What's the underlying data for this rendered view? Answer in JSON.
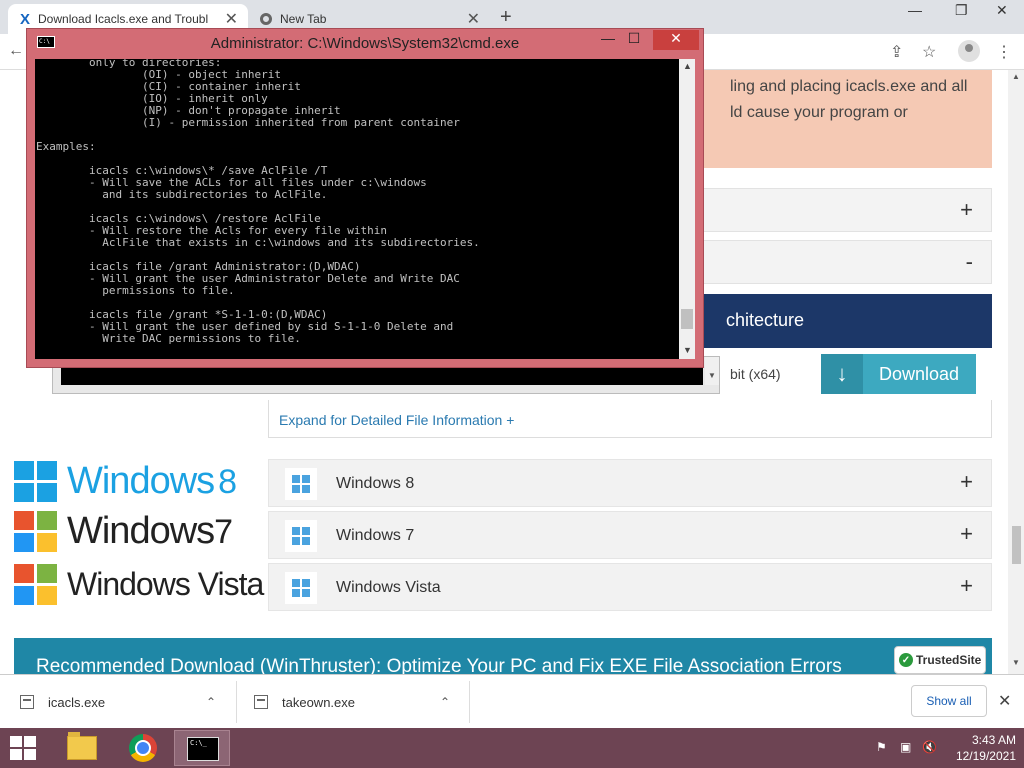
{
  "browser": {
    "tabs": [
      {
        "title": "Download Icacls.exe and Trouble",
        "close": "✕"
      },
      {
        "title": "New Tab",
        "close": "✕"
      }
    ],
    "new_tab": "+",
    "window_controls": {
      "minimize": "—",
      "restore": "❐",
      "close": "✕"
    },
    "back": "←",
    "share": "⇪",
    "bookmark": "☆",
    "menu": "⋮"
  },
  "page": {
    "banner_text": "ling and placing icacls.exe and all\nld cause your program or",
    "accordion_expand": "+",
    "accordion_collapse": "-",
    "architecture_title": "chitecture",
    "bit_label": "bit (x64)",
    "download_button": "Download",
    "download_arrow": "↓",
    "expand_details": "Expand for Detailed File Information +",
    "os_logos": [
      {
        "name": "Windows 8",
        "sup": "8"
      },
      {
        "name": "Windows 7",
        "sup": "7"
      },
      {
        "name": "Windows Vista"
      }
    ],
    "os_logo_text": [
      "Windows",
      "Windows",
      "Windows Vista"
    ],
    "os_logo_num": [
      "8",
      "7"
    ],
    "os_rows": [
      {
        "label": "Windows 8",
        "expand": "+"
      },
      {
        "label": "Windows 7",
        "expand": "+"
      },
      {
        "label": "Windows Vista",
        "expand": "+"
      }
    ],
    "recommended": "Recommended Download (WinThruster): Optimize Your PC and Fix EXE File Association Errors",
    "trusted_site": "TrustedSite",
    "trusted_check": "✓"
  },
  "cmd": {
    "title": "Administrator: C:\\Windows\\System32\\cmd.exe",
    "icon_text": "C:\\",
    "minimize": "—",
    "maximize": "☐",
    "close": "✕",
    "console_text": "        only to directories:\n                (OI) - object inherit\n                (CI) - container inherit\n                (IO) - inherit only\n                (NP) - don't propagate inherit\n                (I) - permission inherited from parent container\n\nExamples:\n\n        icacls c:\\windows\\* /save AclFile /T\n        - Will save the ACLs for all files under c:\\windows\n          and its subdirectories to AclFile.\n\n        icacls c:\\windows\\ /restore AclFile\n        - Will restore the Acls for every file within\n          AclFile that exists in c:\\windows and its subdirectories.\n\n        icacls file /grant Administrator:(D,WDAC)\n        - Will grant the user Administrator Delete and Write DAC\n          permissions to file.\n\n        icacls file /grant *S-1-1-0:(D,WDAC)\n        - Will grant the user defined by sid S-1-1-0 Delete and\n          Write DAC permissions to file.",
    "scroll_up": "▲",
    "scroll_down": "▼"
  },
  "downloads": {
    "items": [
      {
        "name": "icacls.exe",
        "chevron": "⌃"
      },
      {
        "name": "takeown.exe",
        "chevron": "⌃"
      }
    ],
    "show_all": "Show all",
    "close": "✕"
  },
  "taskbar": {
    "cmd_icon_text": "C:\\_",
    "time": "3:43 AM",
    "date": "12/19/2021",
    "tray": [
      "⚑",
      "▣",
      "🔇"
    ]
  },
  "colors": {
    "cmd_frame": "#d36c75",
    "taskbar": "#6d4453",
    "download_button": "#3da9c0",
    "architecture_bar": "#1c3768",
    "banner": "#f5c9b4",
    "windows8_blue": "#1ba1e2"
  },
  "icons": {
    "tab1": "site-x-logo-icon",
    "tab2": "chrome-icon",
    "back": "back-arrow-icon",
    "share": "share-icon",
    "bookmark": "star-icon",
    "profile": "avatar-icon",
    "menu": "kebab-menu-icon"
  }
}
